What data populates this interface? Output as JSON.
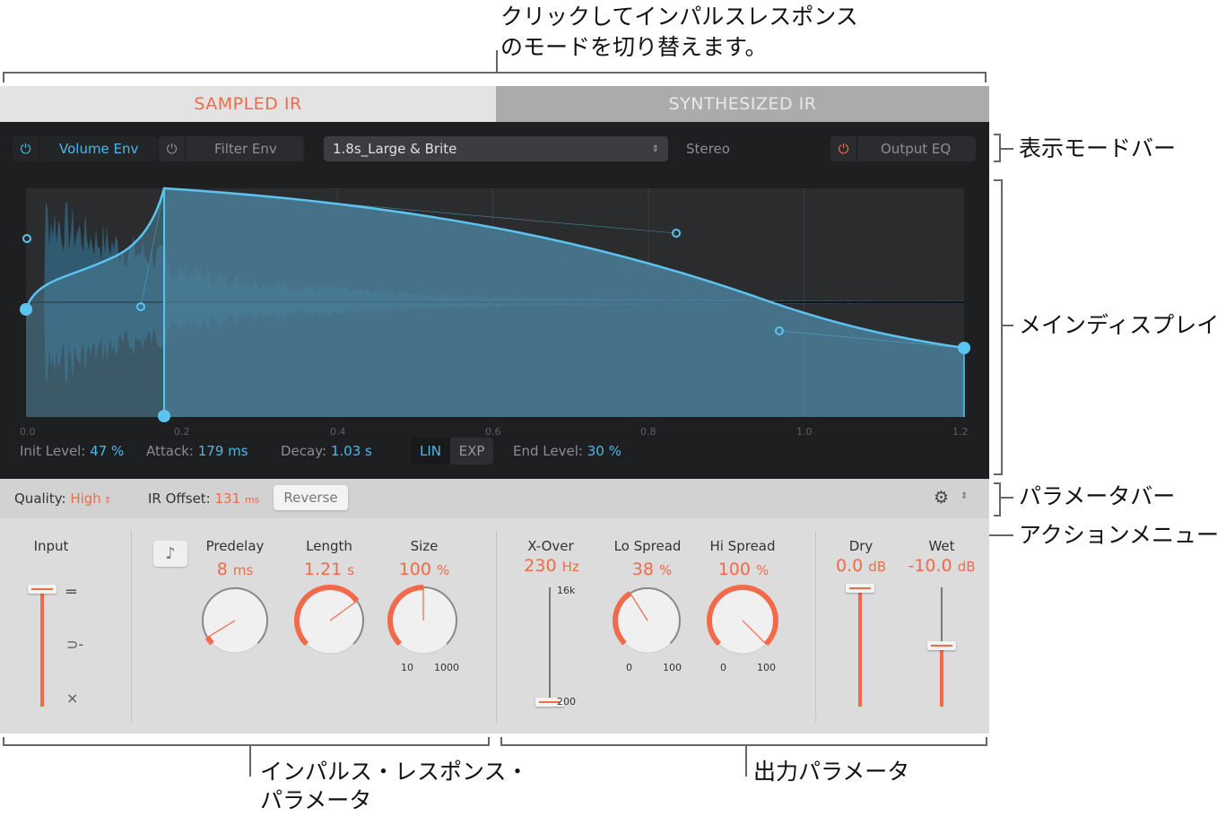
{
  "annotations": {
    "mode_toggle": "クリックしてインパルスレスポンス",
    "mode_toggle2": "のモードを切り替えます。",
    "view_bar": "表示モードバー",
    "main_display": "メインディスプレイ",
    "param_bar": "パラメータバー",
    "action_menu": "アクションメニュー",
    "ir_params": "インパルス・レスポンス・",
    "ir_params2": "パラメータ",
    "output_params": "出力パラメータ"
  },
  "tabs": [
    {
      "label": "SAMPLED IR",
      "active": true
    },
    {
      "label": "SYNTHESIZED IR",
      "active": false
    }
  ],
  "view_bar": {
    "volume_env": "Volume Env",
    "filter_env": "Filter Env",
    "ir_preset": "1.8s_Large & Brite",
    "channel": "Stereo",
    "output_eq": "Output EQ"
  },
  "display": {
    "x_ticks": [
      "0.0",
      "0.2",
      "0.4",
      "0.6",
      "0.8",
      "1.0",
      "1.2"
    ],
    "init_level_label": "Init Level:",
    "init_level": "47 %",
    "attack_label": "Attack:",
    "attack": "179 ms",
    "decay_label": "Decay:",
    "decay": "1.03 s",
    "lin": "LIN",
    "exp": "EXP",
    "end_level_label": "End Level:",
    "end_level": "30 %"
  },
  "param_bar": {
    "quality_label": "Quality:",
    "quality": "High",
    "ir_offset_label": "IR Offset:",
    "ir_offset": "131",
    "ir_offset_unit": "ms",
    "reverse": "Reverse"
  },
  "controls": {
    "input": "Input",
    "predelay": {
      "label": "Predelay",
      "value": "8",
      "unit": "ms",
      "fill": 0.05
    },
    "length": {
      "label": "Length",
      "value": "1.21",
      "unit": "s",
      "fill": 0.7
    },
    "size": {
      "label": "Size",
      "value": "100",
      "unit": "%",
      "fill": 0.5,
      "min": "10",
      "max": "1000"
    },
    "xover": {
      "label": "X-Over",
      "value": "230",
      "unit": "Hz",
      "max": "16k",
      "min": "200",
      "fill": 0.0
    },
    "lo_spread": {
      "label": "Lo Spread",
      "value": "38",
      "unit": "%",
      "fill": 0.38,
      "min": "0",
      "max": "100"
    },
    "hi_spread": {
      "label": "Hi Spread",
      "value": "100",
      "unit": "%",
      "fill": 1.0,
      "min": "0",
      "max": "100"
    },
    "dry": {
      "label": "Dry",
      "value": "0.0",
      "unit": "dB",
      "fill": 1.0
    },
    "wet": {
      "label": "Wet",
      "value": "-10.0",
      "unit": "dB",
      "fill": 0.52
    }
  },
  "colors": {
    "accent": "#f26a4a",
    "blue": "#4ab8ea"
  }
}
